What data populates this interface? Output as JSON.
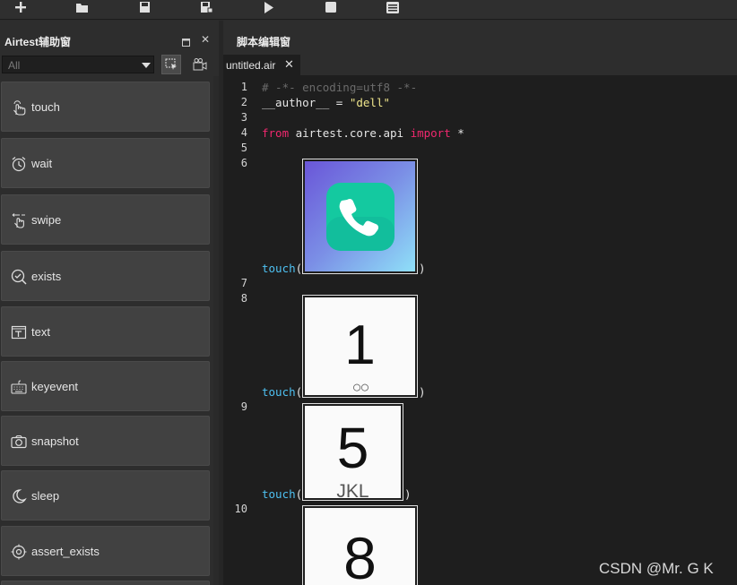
{
  "toolbar": {
    "buttons": [
      "new-icon",
      "open-icon",
      "save-icon",
      "save-as-icon",
      "run-icon",
      "stop-icon",
      "log-icon"
    ]
  },
  "left_panel": {
    "title": "Airtest辅助窗",
    "filter_value": "All",
    "api_buttons": [
      {
        "label": "touch",
        "icon": "hand-touch-icon"
      },
      {
        "label": "wait",
        "icon": "clock-icon"
      },
      {
        "label": "swipe",
        "icon": "hand-swipe-icon"
      },
      {
        "label": "exists",
        "icon": "search-check-icon"
      },
      {
        "label": "text",
        "icon": "text-box-icon"
      },
      {
        "label": "keyevent",
        "icon": "keyboard-icon"
      },
      {
        "label": "snapshot",
        "icon": "camera-icon"
      },
      {
        "label": "sleep",
        "icon": "moon-icon"
      },
      {
        "label": "assert_exists",
        "icon": "target-icon"
      }
    ]
  },
  "editor": {
    "title": "脚本编辑窗",
    "tab_label": "untitled.air",
    "lines": {
      "l1": {
        "num": "1",
        "comment": "# -*- encoding=utf8 -*-"
      },
      "l2": {
        "num": "2",
        "var": "__author__",
        "eq": " = ",
        "str": "\"dell\""
      },
      "l3": {
        "num": "3"
      },
      "l4": {
        "num": "4",
        "kw1": "from",
        "mod": " airtest.core.api ",
        "kw2": "import",
        "rest": " *"
      },
      "l5": {
        "num": "5"
      },
      "l6": {
        "num": "6"
      },
      "l7": {
        "num": "7"
      },
      "l8": {
        "num": "8"
      },
      "l9": {
        "num": "9"
      },
      "l10": {
        "num": "10"
      }
    },
    "touch_fn": "touch",
    "open_paren": "(",
    "close_paren": ")",
    "thumbs": [
      {
        "digit": "",
        "sub": "",
        "kind": "phone-app-icon"
      },
      {
        "digit": "1",
        "sub": "○○"
      },
      {
        "digit": "5",
        "sub": "JKL"
      },
      {
        "digit": "8",
        "sub": ""
      }
    ]
  },
  "watermark": "CSDN @Mr. G K",
  "colors": {
    "accent_keyword": "#f0286e",
    "function": "#4ec1f2",
    "string": "#f0e68c",
    "comment": "#6b6b6b"
  }
}
